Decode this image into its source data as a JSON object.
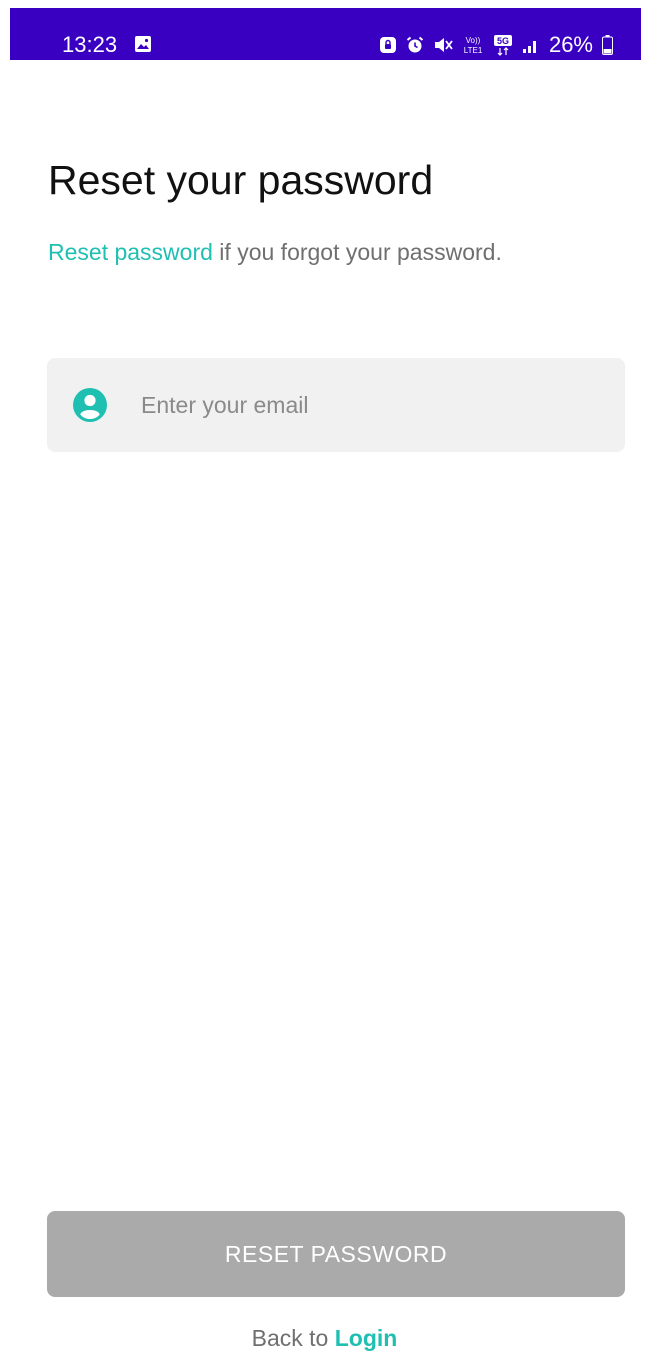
{
  "status_bar": {
    "time": "13:23",
    "battery": "26%",
    "background_color": "#3a00c2",
    "icons": [
      "gallery-icon",
      "lock-app-icon",
      "alarm-icon",
      "mute-icon",
      "volte-icon",
      "5g-icon",
      "signal-icon",
      "battery-icon"
    ],
    "volte_label": "Vo)) LTE1",
    "network_label": "5G"
  },
  "header": {
    "title": "Reset your password",
    "subtitle_link": "Reset password",
    "subtitle_rest": " if you forgot your password."
  },
  "form": {
    "email_placeholder": "Enter your email",
    "email_value": "",
    "email_icon": "user-icon"
  },
  "actions": {
    "reset_label": "RESET PASSWORD",
    "back_prefix": "Back to ",
    "login_label": "Login"
  },
  "colors": {
    "accent": "#1fbfb1",
    "button_disabled": "#aaaaaa",
    "field_background": "#f1f1f1"
  }
}
